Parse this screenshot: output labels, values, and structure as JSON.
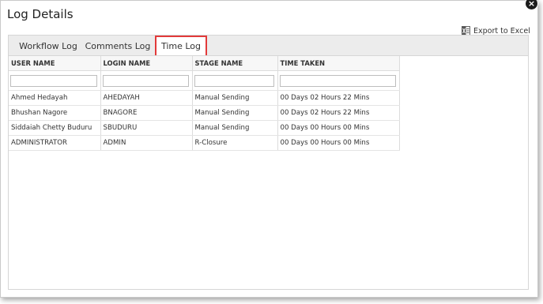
{
  "dialog": {
    "title": "Log Details",
    "close_label": "×",
    "export_label": "Export to Excel"
  },
  "tabs": [
    {
      "label": "Workflow Log",
      "active": false
    },
    {
      "label": "Comments Log",
      "active": false
    },
    {
      "label": "Time Log",
      "active": true
    }
  ],
  "grid": {
    "columns": [
      "USER NAME",
      "LOGIN NAME",
      "STAGE NAME",
      "TIME TAKEN"
    ],
    "rows": [
      [
        "Ahmed Hedayah",
        "AHEDAYAH",
        "Manual Sending",
        "00 Days 02 Hours 22 Mins"
      ],
      [
        "Bhushan Nagore",
        "BNAGORE",
        "Manual Sending",
        "00 Days 02 Hours 22 Mins"
      ],
      [
        "Siddaiah Chetty Buduru",
        "SBUDURU",
        "Manual Sending",
        "00 Days 00 Hours 00 Mins"
      ],
      [
        "ADMINISTRATOR",
        "ADMIN",
        "R-Closure",
        "00 Days 00 Hours 00 Mins"
      ]
    ]
  },
  "colors": {
    "active_tab_border": "#e23a3a",
    "tab_bar": "#ececec"
  },
  "icons": {
    "export": "excel-icon",
    "close": "close-icon"
  }
}
